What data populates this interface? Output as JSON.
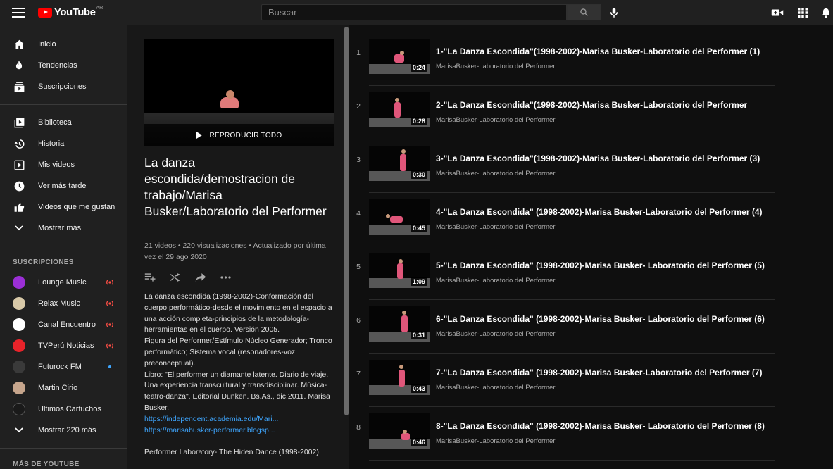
{
  "header": {
    "brand": "YouTube",
    "region": "AR",
    "search_placeholder": "Buscar"
  },
  "sidebar": {
    "main": [
      {
        "label": "Inicio",
        "icon": "home-icon"
      },
      {
        "label": "Tendencias",
        "icon": "flame-icon"
      },
      {
        "label": "Suscripciones",
        "icon": "subscriptions-icon"
      }
    ],
    "library": [
      {
        "label": "Biblioteca",
        "icon": "library-icon"
      },
      {
        "label": "Historial",
        "icon": "history-icon"
      },
      {
        "label": "Mis videos",
        "icon": "my-videos-icon"
      },
      {
        "label": "Ver más tarde",
        "icon": "watch-later-icon"
      },
      {
        "label": "Videos que me gustan",
        "icon": "thumbs-up-icon"
      },
      {
        "label": "Mostrar más",
        "icon": "chevron-down-icon"
      }
    ],
    "subscriptions_heading": "SUSCRIPCIONES",
    "subscriptions": [
      {
        "label": "Lounge Music",
        "indicator": "live",
        "avatar_color": "#9b2fd6"
      },
      {
        "label": "Relax Music",
        "indicator": "live",
        "avatar_color": "#d8c9a8"
      },
      {
        "label": "Canal Encuentro",
        "indicator": "live",
        "avatar_color": "#ffffff"
      },
      {
        "label": "TVPerú Noticias",
        "indicator": "live",
        "avatar_color": "#e8232a"
      },
      {
        "label": "Futurock FM",
        "indicator": "new",
        "avatar_color": "#3a3a3a"
      },
      {
        "label": "Martin Cirio",
        "indicator": "none",
        "avatar_color": "#c6a58c"
      },
      {
        "label": "Ultimos Cartuchos",
        "indicator": "none",
        "avatar_color": "#1a1a1a"
      }
    ],
    "show_more_subs": "Mostrar 220 más",
    "more_heading": "MÁS DE YOUTUBE"
  },
  "playlist": {
    "play_all": "REPRODUCIR TODO",
    "title": "La danza escondida/demostracion de trabajo/Marisa Busker/Laboratorio del Performer",
    "stats": "21 videos • 220 visualizaciones • Actualizado por última vez el 29 ago 2020",
    "description": "La danza escondida (1998-2002)-Conformación del cuerpo performático-desde el movimiento en el espacio a una acción completa-principios de la metodología-\nherramientas en el cuerpo. Versión 2005.\nFigura del Performer/Estímulo Núcleo Generador; Tronco performático; Sistema vocal (resonadores-voz preconceptual).\nLibro: \"El performer un diamante latente. Diario de viaje. Una experiencia transcultural y transdisciplinar. Música-teatro-danza\". Editorial Dunken. Bs.As., dic.2011. Marisa Busker.",
    "link1": "https://independent.academia.edu/Mari...",
    "link2": "https://marisabusker-performer.blogsp...",
    "description_end": "Performer Laboratory- The Hiden Dance (1998-2002)"
  },
  "videos": [
    {
      "index": "1",
      "title": "1-\"La Danza Escondida\"(1998-2002)-Marisa Busker-Laboratorio del Performer (1)",
      "channel": "MarisaBusker-Laboratorio del Performer",
      "duration": "0:24"
    },
    {
      "index": "2",
      "title": "2-\"La Danza Escondida\"(1998-2002)-Marisa Busker-Laboratorio del Performer",
      "channel": "MarisaBusker-Laboratorio del Performer",
      "duration": "0:28"
    },
    {
      "index": "3",
      "title": "3-\"La Danza Escondida\"(1998-2002)-Marisa Busker-Laboratorio del Performer (3)",
      "channel": "MarisaBusker-Laboratorio del Performer",
      "duration": "0:30"
    },
    {
      "index": "4",
      "title": "4-\"La Danza Escondida\" (1998-2002)-Marisa Busker-Laboratorio del Performer (4)",
      "channel": "MarisaBusker-Laboratorio del Performer",
      "duration": "0:45"
    },
    {
      "index": "5",
      "title": "5-\"La Danza Escondida\" (1998-2002)-Marisa Busker- Laboratorio del Performer (5)",
      "channel": "MarisaBusker-Laboratorio del Performer",
      "duration": "1:09"
    },
    {
      "index": "6",
      "title": "6-\"La Danza Escondida\" (1998-2002)-Marisa Busker- Laboratorio del Performer (6)",
      "channel": "MarisaBusker-Laboratorio del Performer",
      "duration": "0:31"
    },
    {
      "index": "7",
      "title": "7-\"La Danza Escondida\" (1998-2002)-Marisa Busker-Laboratorio del Performer (7)",
      "channel": "MarisaBusker-Laboratorio del Performer",
      "duration": "0:43"
    },
    {
      "index": "8",
      "title": "8-\"La Danza Escondida\" (1998-2002)-Marisa Busker- Laboratorio del Performer (8)",
      "channel": "MarisaBusker-Laboratorio del Performer",
      "duration": "0:46"
    }
  ],
  "colors": {
    "brand": "#ff0000",
    "link": "#3ea6ff",
    "live": "#ff4e45"
  }
}
